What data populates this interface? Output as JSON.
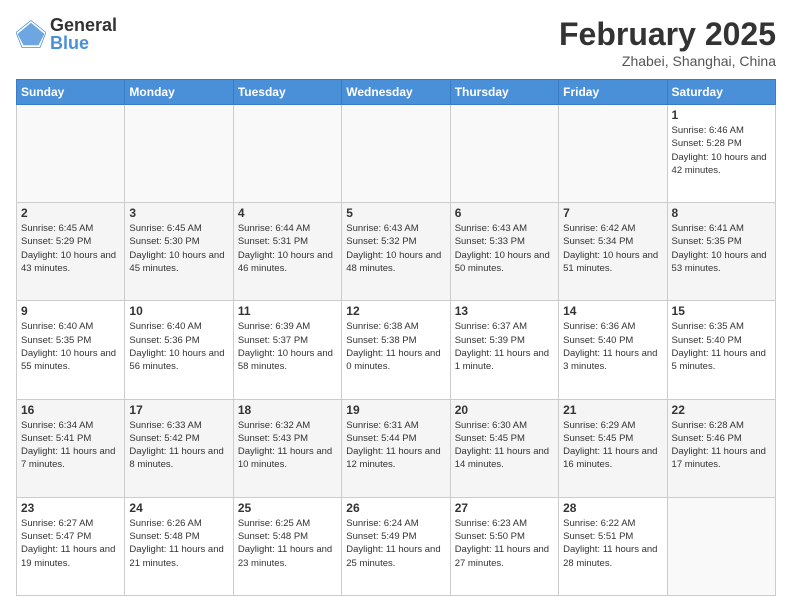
{
  "logo": {
    "general": "General",
    "blue": "Blue"
  },
  "title": "February 2025",
  "location": "Zhabei, Shanghai, China",
  "weekdays": [
    "Sunday",
    "Monday",
    "Tuesday",
    "Wednesday",
    "Thursday",
    "Friday",
    "Saturday"
  ],
  "weeks": [
    [
      {
        "day": "",
        "info": ""
      },
      {
        "day": "",
        "info": ""
      },
      {
        "day": "",
        "info": ""
      },
      {
        "day": "",
        "info": ""
      },
      {
        "day": "",
        "info": ""
      },
      {
        "day": "",
        "info": ""
      },
      {
        "day": "1",
        "info": "Sunrise: 6:46 AM\nSunset: 5:28 PM\nDaylight: 10 hours\nand 42 minutes."
      }
    ],
    [
      {
        "day": "2",
        "info": "Sunrise: 6:45 AM\nSunset: 5:29 PM\nDaylight: 10 hours\nand 43 minutes."
      },
      {
        "day": "3",
        "info": "Sunrise: 6:45 AM\nSunset: 5:30 PM\nDaylight: 10 hours\nand 45 minutes."
      },
      {
        "day": "4",
        "info": "Sunrise: 6:44 AM\nSunset: 5:31 PM\nDaylight: 10 hours\nand 46 minutes."
      },
      {
        "day": "5",
        "info": "Sunrise: 6:43 AM\nSunset: 5:32 PM\nDaylight: 10 hours\nand 48 minutes."
      },
      {
        "day": "6",
        "info": "Sunrise: 6:43 AM\nSunset: 5:33 PM\nDaylight: 10 hours\nand 50 minutes."
      },
      {
        "day": "7",
        "info": "Sunrise: 6:42 AM\nSunset: 5:34 PM\nDaylight: 10 hours\nand 51 minutes."
      },
      {
        "day": "8",
        "info": "Sunrise: 6:41 AM\nSunset: 5:35 PM\nDaylight: 10 hours\nand 53 minutes."
      }
    ],
    [
      {
        "day": "9",
        "info": "Sunrise: 6:40 AM\nSunset: 5:35 PM\nDaylight: 10 hours\nand 55 minutes."
      },
      {
        "day": "10",
        "info": "Sunrise: 6:40 AM\nSunset: 5:36 PM\nDaylight: 10 hours\nand 56 minutes."
      },
      {
        "day": "11",
        "info": "Sunrise: 6:39 AM\nSunset: 5:37 PM\nDaylight: 10 hours\nand 58 minutes."
      },
      {
        "day": "12",
        "info": "Sunrise: 6:38 AM\nSunset: 5:38 PM\nDaylight: 11 hours\nand 0 minutes."
      },
      {
        "day": "13",
        "info": "Sunrise: 6:37 AM\nSunset: 5:39 PM\nDaylight: 11 hours\nand 1 minute."
      },
      {
        "day": "14",
        "info": "Sunrise: 6:36 AM\nSunset: 5:40 PM\nDaylight: 11 hours\nand 3 minutes."
      },
      {
        "day": "15",
        "info": "Sunrise: 6:35 AM\nSunset: 5:40 PM\nDaylight: 11 hours\nand 5 minutes."
      }
    ],
    [
      {
        "day": "16",
        "info": "Sunrise: 6:34 AM\nSunset: 5:41 PM\nDaylight: 11 hours\nand 7 minutes."
      },
      {
        "day": "17",
        "info": "Sunrise: 6:33 AM\nSunset: 5:42 PM\nDaylight: 11 hours\nand 8 minutes."
      },
      {
        "day": "18",
        "info": "Sunrise: 6:32 AM\nSunset: 5:43 PM\nDaylight: 11 hours\nand 10 minutes."
      },
      {
        "day": "19",
        "info": "Sunrise: 6:31 AM\nSunset: 5:44 PM\nDaylight: 11 hours\nand 12 minutes."
      },
      {
        "day": "20",
        "info": "Sunrise: 6:30 AM\nSunset: 5:45 PM\nDaylight: 11 hours\nand 14 minutes."
      },
      {
        "day": "21",
        "info": "Sunrise: 6:29 AM\nSunset: 5:45 PM\nDaylight: 11 hours\nand 16 minutes."
      },
      {
        "day": "22",
        "info": "Sunrise: 6:28 AM\nSunset: 5:46 PM\nDaylight: 11 hours\nand 17 minutes."
      }
    ],
    [
      {
        "day": "23",
        "info": "Sunrise: 6:27 AM\nSunset: 5:47 PM\nDaylight: 11 hours\nand 19 minutes."
      },
      {
        "day": "24",
        "info": "Sunrise: 6:26 AM\nSunset: 5:48 PM\nDaylight: 11 hours\nand 21 minutes."
      },
      {
        "day": "25",
        "info": "Sunrise: 6:25 AM\nSunset: 5:48 PM\nDaylight: 11 hours\nand 23 minutes."
      },
      {
        "day": "26",
        "info": "Sunrise: 6:24 AM\nSunset: 5:49 PM\nDaylight: 11 hours\nand 25 minutes."
      },
      {
        "day": "27",
        "info": "Sunrise: 6:23 AM\nSunset: 5:50 PM\nDaylight: 11 hours\nand 27 minutes."
      },
      {
        "day": "28",
        "info": "Sunrise: 6:22 AM\nSunset: 5:51 PM\nDaylight: 11 hours\nand 28 minutes."
      },
      {
        "day": "",
        "info": ""
      }
    ]
  ]
}
